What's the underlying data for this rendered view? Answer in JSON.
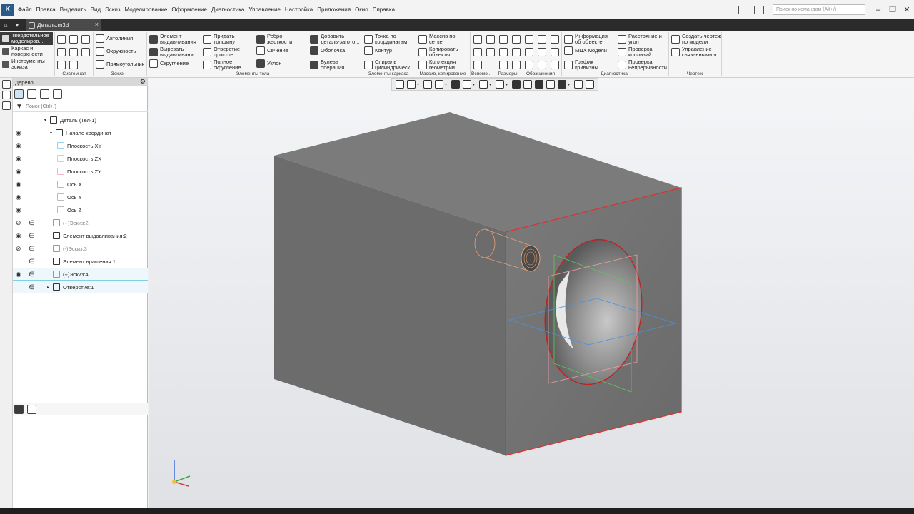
{
  "menu": [
    "Файл",
    "Правка",
    "Выделить",
    "Вид",
    "Эскиз",
    "Моделирование",
    "Оформление",
    "Диагностика",
    "Управление",
    "Настройка",
    "Приложения",
    "Окно",
    "Справка"
  ],
  "command_search_placeholder": "Поиск по командам (Alt+/)",
  "tab": {
    "title": "Деталь.m3d",
    "close": "×"
  },
  "modes": [
    {
      "label": "Твердотельное моделиров...",
      "active": true
    },
    {
      "label": "Каркас и поверхности",
      "active": false
    },
    {
      "label": "Инструменты эскиза",
      "active": false
    }
  ],
  "ribbon": {
    "eskiz": {
      "autoline": "Автолиния",
      "circle": "Окружность",
      "rectangle": "Прямоугольник"
    },
    "body": {
      "extrude": "Элемент выдавливания",
      "cut_extrude": "Вырезать выдавливани...",
      "fillet": "Скругление",
      "thicken": "Придать толщину",
      "hole_simple": "Отверстие простое",
      "full_fillet": "Полное скругление",
      "rib": "Ребро жесткости",
      "section": "Сечение",
      "draft": "Уклон",
      "add_part": "Добавить деталь-загото...",
      "shell": "Оболочка",
      "boolean": "Булева операция"
    },
    "frame": {
      "point_coords": "Точка по координатам",
      "contour": "Контур",
      "spiral": "Спираль цилиндрическ..."
    },
    "array": {
      "grid_array": "Массив по сетке",
      "copy_objects": "Копировать объекты",
      "geometry_collection": "Коллекция геометрии"
    },
    "diagnostics": {
      "info": "Информация об объекте",
      "mcx": "МЦХ модели",
      "curvature": "График кривизны",
      "distance": "Расстояние и угол",
      "collisions": "Проверка коллизий",
      "continuity": "Проверка непрерывности"
    },
    "drawing": {
      "create_drawing": "Создать чертеж по модели",
      "linked_views": "Управление связанными ч..."
    },
    "group_labels": {
      "system": "Системная",
      "eskiz": "Эскиз",
      "body": "Элементы тела",
      "frame": "Элементы каркаса",
      "array": "Массив, копирование",
      "aux": "Вспомо...",
      "dims": "Размеры",
      "notation": "Обозначения",
      "diag": "Диагностика",
      "drawing": "Чертеж"
    }
  },
  "tree_panel": {
    "title": "Дерево",
    "search_placeholder": "Поиск (Ctrl+/)",
    "nodes": [
      {
        "label": "Деталь (Тел-1)",
        "eye": false,
        "rel": false,
        "dim": false
      },
      {
        "label": "Начало координат",
        "eye": true,
        "rel": false,
        "dim": false
      },
      {
        "label": "Плоскость XY",
        "eye": true,
        "rel": false,
        "dim": false
      },
      {
        "label": "Плоскость ZX",
        "eye": true,
        "rel": false,
        "dim": false
      },
      {
        "label": "Плоскость ZY",
        "eye": true,
        "rel": false,
        "dim": false
      },
      {
        "label": "Ось X",
        "eye": true,
        "rel": false,
        "dim": false
      },
      {
        "label": "Ось Y",
        "eye": true,
        "rel": false,
        "dim": false
      },
      {
        "label": "Ось Z",
        "eye": true,
        "rel": false,
        "dim": false
      },
      {
        "label": "(+)Эскиз:2",
        "eye": "hidden",
        "rel": true,
        "dim": true
      },
      {
        "label": "Элемент выдавливания:2",
        "eye": true,
        "rel": true,
        "dim": false
      },
      {
        "label": "(-)Эскиз:3",
        "eye": "hidden",
        "rel": true,
        "dim": true
      },
      {
        "label": "Элемент вращения:1",
        "eye": false,
        "rel": true,
        "dim": false
      },
      {
        "label": "(+)Эскиз:4",
        "eye": true,
        "rel": true,
        "dim": false
      },
      {
        "label": "Отверстие:1",
        "eye": false,
        "rel": true,
        "dim": false
      }
    ]
  },
  "colors": {
    "selection_edge": "#e03030",
    "ghost_cylinder": "#e8a070",
    "plane_green": "#5ac85a",
    "plane_blue": "#4a90e0",
    "plane_red": "#f0a0a0"
  }
}
